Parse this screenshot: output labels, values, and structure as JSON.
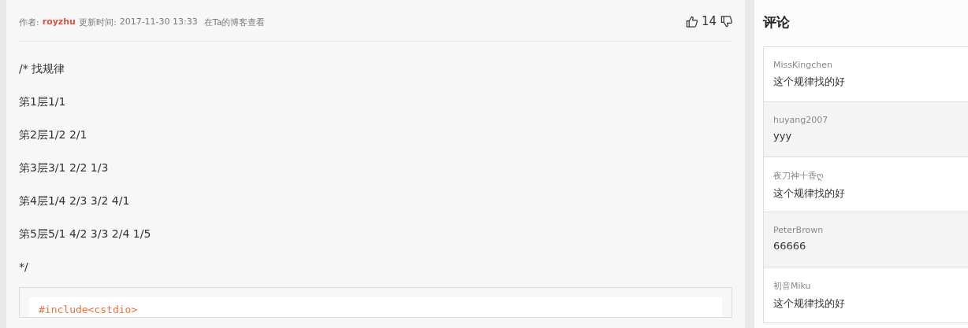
{
  "article": {
    "meta": {
      "author_label": "作者:",
      "author": "royzhu",
      "updated_label": "更新时间:",
      "updated": "2017-11-30 13:33",
      "blog_link": "在Ta的博客查看"
    },
    "votes": {
      "count": "14"
    },
    "lines": [
      "/* 找规律",
      "第1层1/1",
      "第2层1/2 2/1",
      "第3层3/1 2/2 1/3",
      "第4层1/4 2/3 3/2 4/1",
      "第5层5/1 4/2 3/3 2/4 1/5",
      "*/"
    ],
    "code": [
      "#include<cstdio>"
    ]
  },
  "comments": {
    "title": "评论",
    "items": [
      {
        "user": "MissKingchen",
        "text": "这个规律找的好"
      },
      {
        "user": "huyang2007",
        "text": "yyy"
      },
      {
        "user": "夜刀神十香ღ",
        "text": "这个规律找的好"
      },
      {
        "user": "PeterBrown",
        "text": "66666"
      },
      {
        "user": "初音Miku",
        "text": "这个规律找的好"
      }
    ]
  }
}
